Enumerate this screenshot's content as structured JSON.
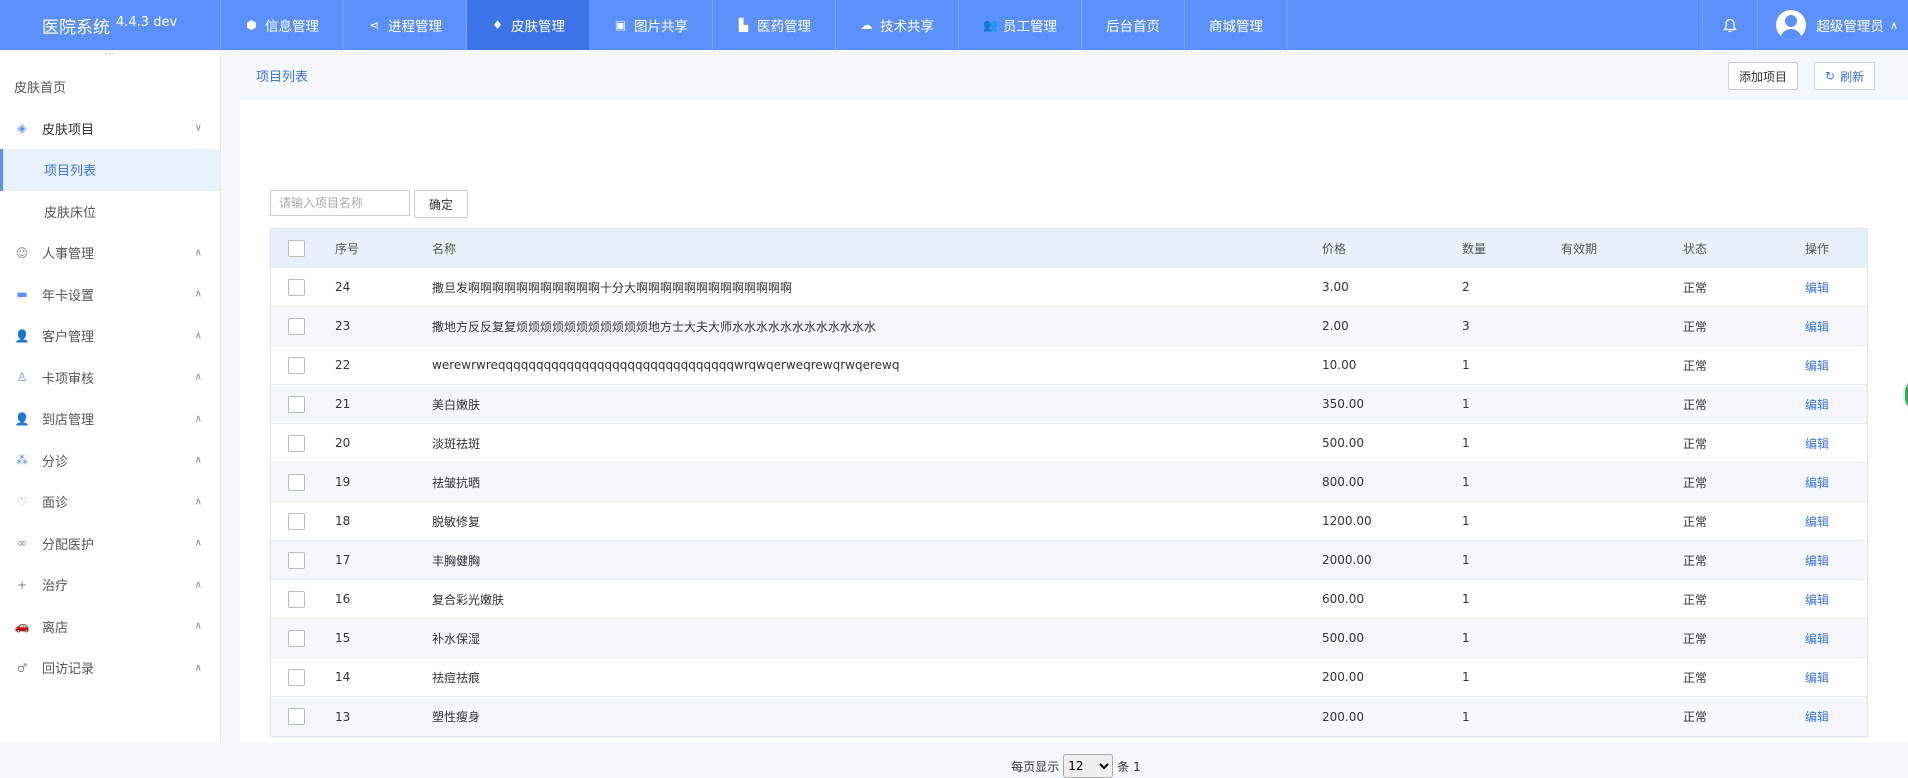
{
  "brand": {
    "name": "医院系统",
    "version": "4.4.3 dev"
  },
  "nav": [
    {
      "icon": "cube-icon",
      "label": "信息管理"
    },
    {
      "icon": "share-icon",
      "label": "进程管理"
    },
    {
      "icon": "leaf-icon",
      "label": "皮肤管理",
      "active": true
    },
    {
      "icon": "image-icon",
      "label": "图片共享"
    },
    {
      "icon": "cart-icon",
      "label": "医药管理"
    },
    {
      "icon": "cloud-icon",
      "label": "技术共享"
    },
    {
      "icon": "users-icon",
      "label": "员工管理"
    },
    {
      "icon": "",
      "label": "后台首页"
    },
    {
      "icon": "",
      "label": "商城管理"
    }
  ],
  "user": {
    "name": "超级管理员"
  },
  "sidebar": {
    "home": "皮肤首页",
    "group": "皮肤项目",
    "sub": [
      "项目列表",
      "皮肤床位"
    ],
    "items": [
      {
        "icon": "smile-icon",
        "label": "人事管理"
      },
      {
        "icon": "folder-icon",
        "label": "年卡设置"
      },
      {
        "icon": "user-gear-icon",
        "label": "客户管理"
      },
      {
        "icon": "stamp-icon",
        "label": "卡项审核"
      },
      {
        "icon": "user-gear-icon",
        "label": "到店管理"
      },
      {
        "icon": "network-icon",
        "label": "分诊"
      },
      {
        "icon": "heart-icon",
        "label": "面诊"
      },
      {
        "icon": "link-icon",
        "label": "分配医护"
      },
      {
        "icon": "plus-icon",
        "label": "治疗"
      },
      {
        "icon": "car-icon",
        "label": "离店"
      },
      {
        "icon": "male-icon",
        "label": "回访记录"
      }
    ]
  },
  "page": {
    "title": "项目列表",
    "add_label": "添加项目",
    "refresh_label": "刷新",
    "search_placeholder": "请输入项目名称",
    "confirm_label": "确定"
  },
  "table": {
    "headers": [
      "序号",
      "名称",
      "价格",
      "数量",
      "有效期",
      "状态",
      "操作"
    ],
    "rows": [
      {
        "no": "24",
        "name": "撒旦发啊啊啊啊啊啊啊啊啊啊啊十分大啊啊啊啊啊啊啊啊啊啊啊啊啊",
        "price": "3.00",
        "qty": "2",
        "valid": "",
        "status": "正常",
        "op": "编辑"
      },
      {
        "no": "23",
        "name": "撒地方反反复复烦烦烦烦烦烦烦烦烦烦烦地方士大夫大师水水水水水水水水水水水水",
        "price": "2.00",
        "qty": "3",
        "valid": "",
        "status": "正常",
        "op": "编辑"
      },
      {
        "no": "22",
        "name": "werewrwreqqqqqqqqqqqqqqqqqqqqqqqqqqqqqqqwrqwqerweqrewqrwqerewq",
        "price": "10.00",
        "qty": "1",
        "valid": "",
        "status": "正常",
        "op": "编辑"
      },
      {
        "no": "21",
        "name": "美白嫩肤",
        "price": "350.00",
        "qty": "1",
        "valid": "",
        "status": "正常",
        "op": "编辑"
      },
      {
        "no": "20",
        "name": "淡斑祛斑",
        "price": "500.00",
        "qty": "1",
        "valid": "",
        "status": "正常",
        "op": "编辑"
      },
      {
        "no": "19",
        "name": "祛皱抗晒",
        "price": "800.00",
        "qty": "1",
        "valid": "",
        "status": "正常",
        "op": "编辑"
      },
      {
        "no": "18",
        "name": "脱敏修复",
        "price": "1200.00",
        "qty": "1",
        "valid": "",
        "status": "正常",
        "op": "编辑"
      },
      {
        "no": "17",
        "name": "丰胸健胸",
        "price": "2000.00",
        "qty": "1",
        "valid": "",
        "status": "正常",
        "op": "编辑"
      },
      {
        "no": "16",
        "name": "复合彩光嫩肤",
        "price": "600.00",
        "qty": "1",
        "valid": "",
        "status": "正常",
        "op": "编辑"
      },
      {
        "no": "15",
        "name": "补水保湿",
        "price": "500.00",
        "qty": "1",
        "valid": "",
        "status": "正常",
        "op": "编辑"
      },
      {
        "no": "14",
        "name": "祛痘祛痕",
        "price": "200.00",
        "qty": "1",
        "valid": "",
        "status": "正常",
        "op": "编辑"
      },
      {
        "no": "13",
        "name": "塑性瘦身",
        "price": "200.00",
        "qty": "1",
        "valid": "",
        "status": "正常",
        "op": "编辑"
      }
    ]
  },
  "pager": {
    "prefix": "每页显示",
    "page_size": "12",
    "suffix": "条 1"
  }
}
